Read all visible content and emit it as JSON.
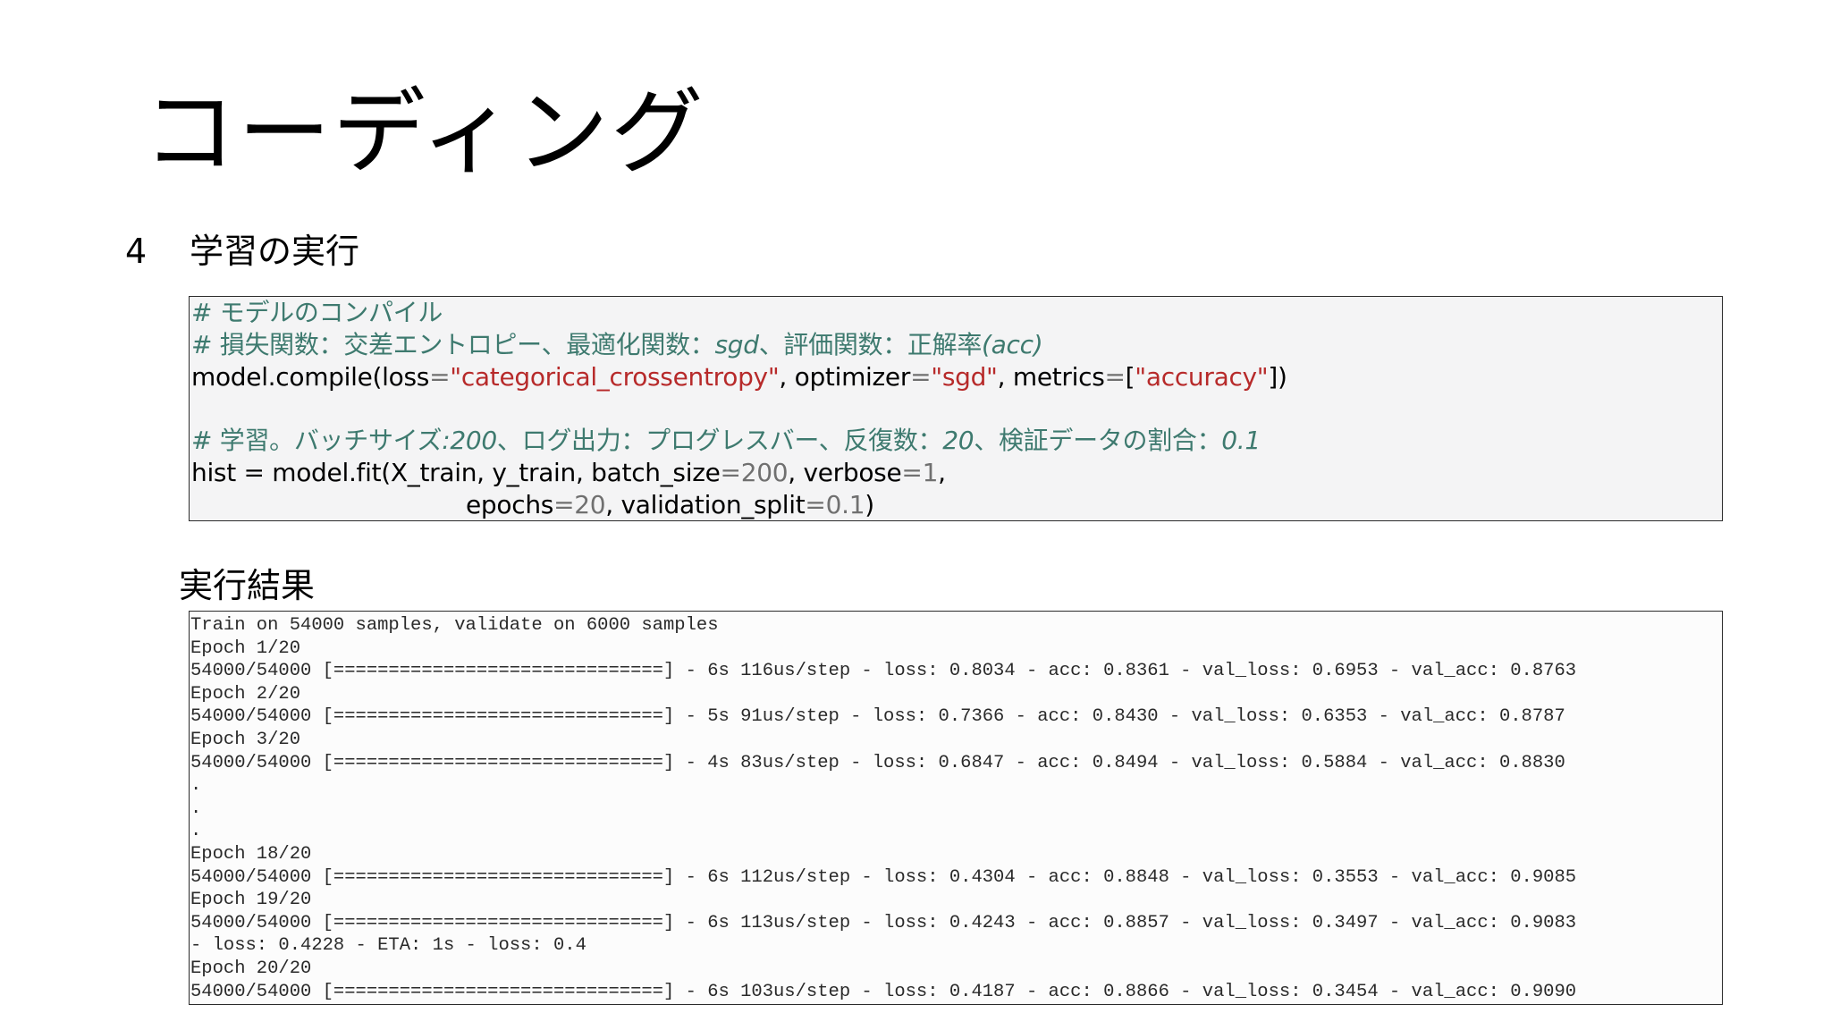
{
  "title": "コーディング",
  "section": {
    "number": "4",
    "label": "学習の実行"
  },
  "code": {
    "comment1": "# モデルのコンパイル",
    "comment2_a": "# 損失関数：交差エントロピー、最適化関数：",
    "comment2_b": "sgd",
    "comment2_c": "、評価関数：正解率",
    "comment2_d": "(acc)",
    "compile_prefix": "model.compile(loss",
    "eq": "=",
    "loss_value": "\"categorical_crossentropy\"",
    "comma_optimizer": ", optimizer",
    "optimizer_value": "\"sgd\"",
    "comma_metrics": ", metrics",
    "bracket_open": "[",
    "metrics_value": "\"accuracy\"",
    "compile_suffix": "])",
    "comment3_a": "# 学習。バッチサイズ",
    "comment3_b": ":200",
    "comment3_c": "、ログ出力：プログレスバー、反復数：",
    "comment3_d": "20",
    "comment3_e": "、検証データの割合：",
    "comment3_f": "0.1",
    "fit_prefix": "hist = model.fit(X_train, y_train, batch_size",
    "batch_size": "200",
    "comma_verbose": ", verbose",
    "verbose": "1",
    "fit_comma": ",",
    "epochs_label": "epochs",
    "epochs_value": "20",
    "comma_validation": ", validation_split",
    "validation_value": "0.1",
    "close_paren": ")"
  },
  "result_heading": "実行結果",
  "output_lines": [
    "Train on 54000 samples, validate on 6000 samples",
    "Epoch 1/20",
    "54000/54000 [==============================] - 6s 116us/step - loss: 0.8034 - acc: 0.8361 - val_loss: 0.6953 - val_acc: 0.8763",
    "Epoch 2/20",
    "54000/54000 [==============================] - 5s 91us/step - loss: 0.7366 - acc: 0.8430 - val_loss: 0.6353 - val_acc: 0.8787",
    "Epoch 3/20",
    "54000/54000 [==============================] - 4s 83us/step - loss: 0.6847 - acc: 0.8494 - val_loss: 0.5884 - val_acc: 0.8830",
    ".",
    ".",
    ".",
    "Epoch 18/20",
    "54000/54000 [==============================] - 6s 112us/step - loss: 0.4304 - acc: 0.8848 - val_loss: 0.3553 - val_acc: 0.9085",
    "Epoch 19/20",
    "54000/54000 [==============================] - 6s 113us/step - loss: 0.4243 - acc: 0.8857 - val_loss: 0.3497 - val_acc: 0.9083",
    "- loss: 0.4228 - ETA: 1s - loss: 0.4",
    "Epoch 20/20",
    "54000/54000 [==============================] - 6s 103us/step - loss: 0.4187 - acc: 0.8866 - val_loss: 0.3454 - val_acc: 0.9090"
  ]
}
